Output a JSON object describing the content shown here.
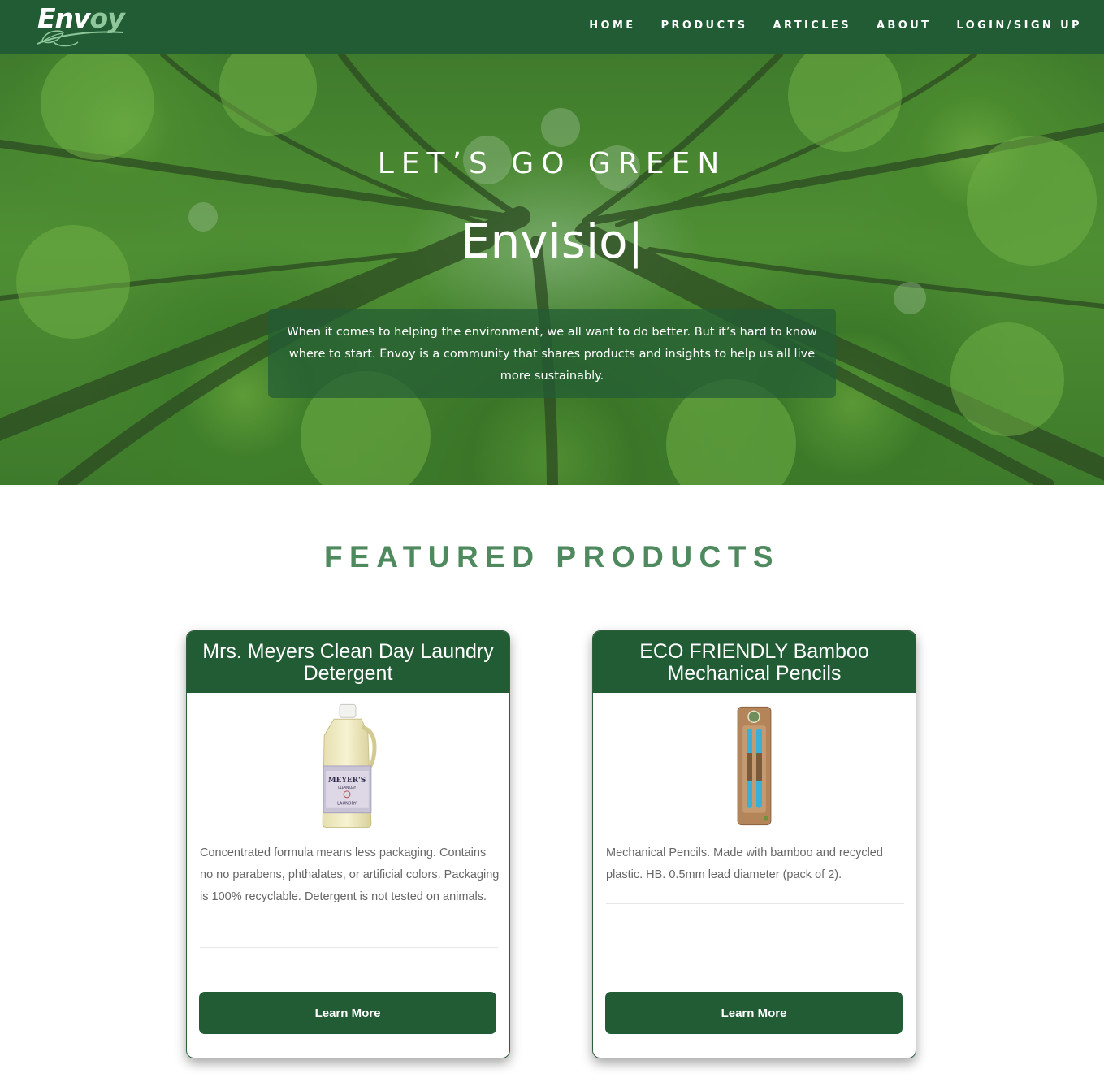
{
  "brand": {
    "name_part1": "Env",
    "name_part2": "oy",
    "primary_color": "#225c35",
    "accent_color": "#8fc79a",
    "heading_color": "#4f8a5f"
  },
  "nav": {
    "items": [
      {
        "label": "HOME"
      },
      {
        "label": "PRODUCTS"
      },
      {
        "label": "ARTICLES"
      },
      {
        "label": "ABOUT"
      },
      {
        "label": "LOGIN/SIGN UP"
      }
    ]
  },
  "hero": {
    "title": "LET’S GO GREEN",
    "typed_text": "Envisio",
    "caret": "|",
    "description": "When it comes to helping the environment, we all want to do better. But it’s hard to know where to start. Envoy is a community that shares products and insights to help us all live more sustainably."
  },
  "featured": {
    "title": "FEATURED PRODUCTS",
    "products": [
      {
        "name": "Mrs. Meyers Clean Day Laundry Detergent",
        "image_label_brand": "MEYER'S",
        "image_label_line": "CLEAN DAY",
        "image_label_product": "LAUNDRY",
        "description": "Concentrated formula means less packaging. Contains no no parabens, phthalates, or artificial colors. Packaging is 100% recyclable. Detergent is not tested on animals.",
        "button_label": "Learn More"
      },
      {
        "name": "ECO FRIENDLY Bamboo Mechanical Pencils",
        "description": "Mechanical Pencils. Made with bamboo and recycled plastic. HB. 0.5mm lead diameter (pack of 2).",
        "button_label": "Learn More"
      }
    ]
  }
}
